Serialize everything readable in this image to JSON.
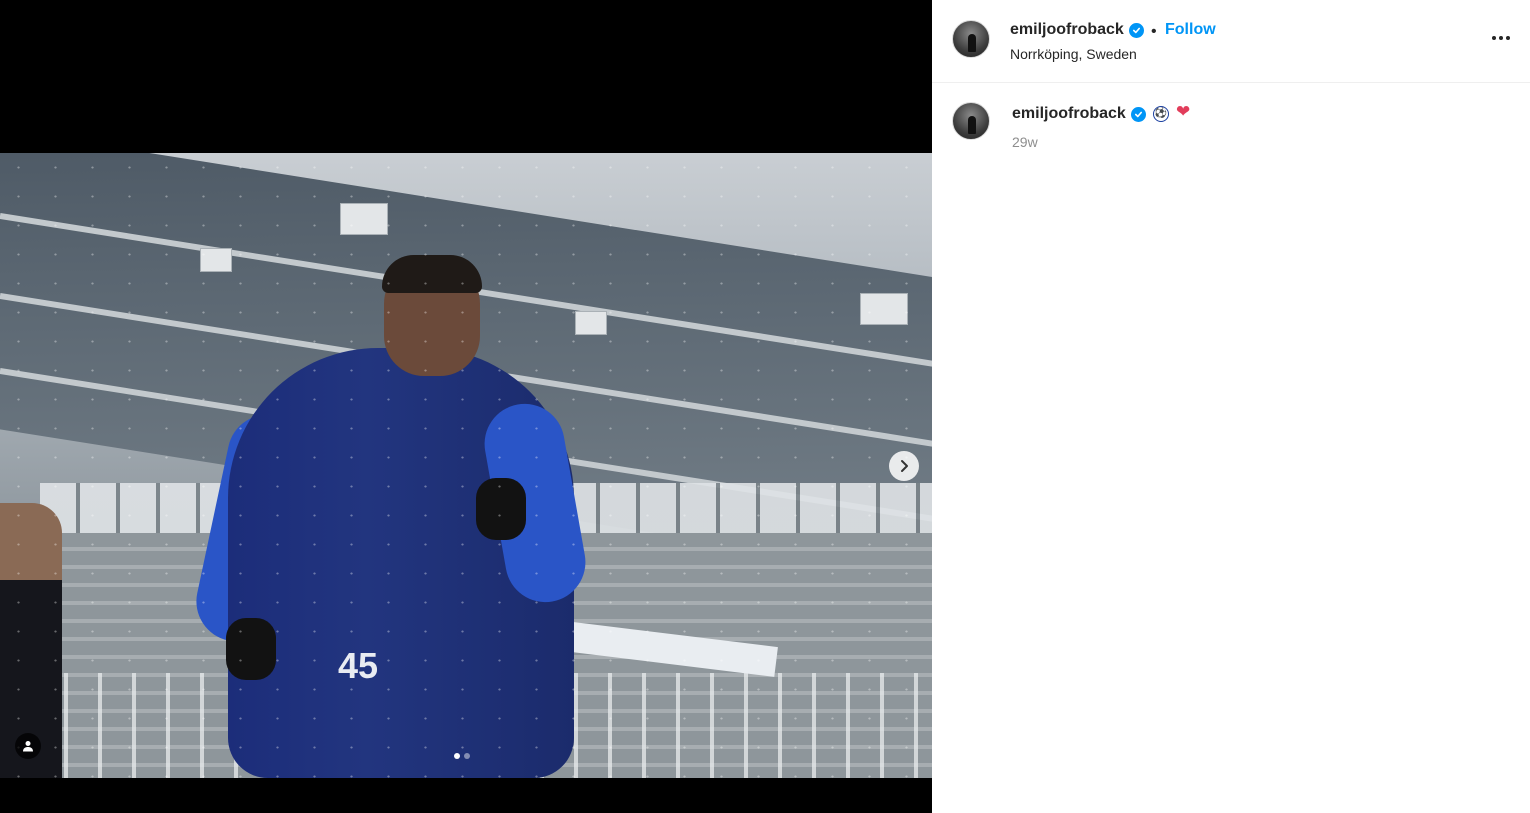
{
  "post": {
    "username": "emiljoofroback",
    "verified_icon": "verified-badge-icon",
    "separator": "•",
    "follow_label": "Follow",
    "location": "Norrköping, Sweden",
    "more_icon": "more-options-icon"
  },
  "media": {
    "image_description_icon": "photo-placeholder",
    "next_icon": "chevron-right-icon",
    "tag_icon": "user-tag-icon",
    "carousel_count": 2,
    "carousel_active_index": 0
  },
  "caption": {
    "username": "emiljoofroback",
    "emoji_1": "⚽",
    "emoji_2": "❤",
    "timestamp": "29w"
  },
  "colors": {
    "link_blue": "#0095f6",
    "text": "#262626",
    "muted": "#8e8e8e",
    "divider": "#efefef"
  }
}
